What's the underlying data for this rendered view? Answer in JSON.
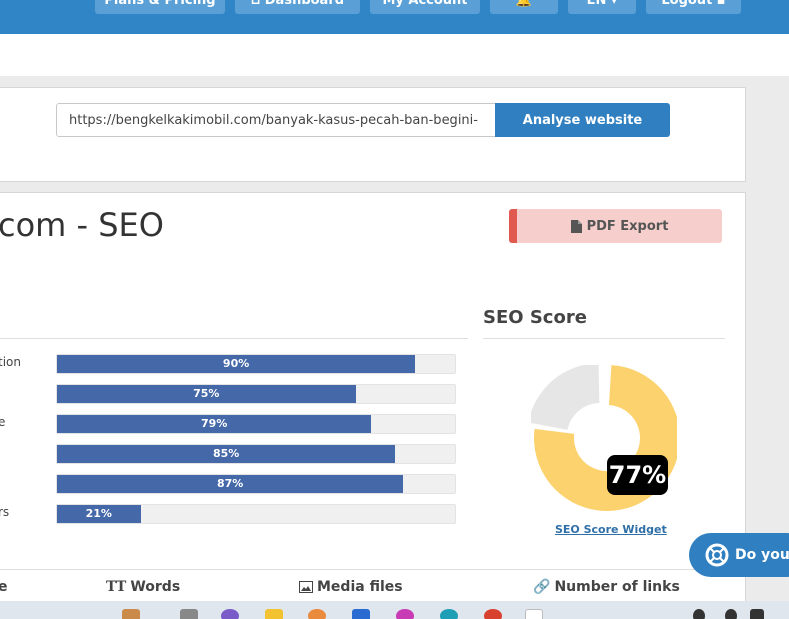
{
  "nav": {
    "items": [
      "Plans & Pricing",
      "Dashboard",
      "My Account",
      "",
      "EN",
      "Logout"
    ]
  },
  "search": {
    "url_value": "https://bengkelkakimobil.com/banyak-kasus-pecah-ban-begini-",
    "analyse_label": "Analyse website"
  },
  "report": {
    "title": "com - SEO",
    "pdf_label": "PDF Export"
  },
  "bars": [
    {
      "label": "tion",
      "value": 90,
      "text": "90%"
    },
    {
      "label": "",
      "value": 75,
      "text": "75%"
    },
    {
      "label": "e",
      "value": 79,
      "text": "79%"
    },
    {
      "label": "",
      "value": 85,
      "text": "85%"
    },
    {
      "label": "",
      "value": 87,
      "text": "87%"
    },
    {
      "label": "rs",
      "value": 21,
      "text": "21%"
    }
  ],
  "seo_score": {
    "heading": "SEO Score",
    "value": 77,
    "value_text": "77%",
    "widget_label": "SEO Score Widget",
    "colors": {
      "score": "#fcd26e",
      "rest": "#e6e6e6"
    }
  },
  "stats": {
    "partial": "e",
    "words": "Words",
    "media": "Media files",
    "links": "Number of links"
  },
  "chat": {
    "label": "Do you n"
  },
  "colors": {
    "nav": "#3085c7",
    "button": "#2f7fc1",
    "bar": "#4468a8",
    "pdf": "#f6cfcc",
    "pdf_accent": "#e05a4f"
  }
}
